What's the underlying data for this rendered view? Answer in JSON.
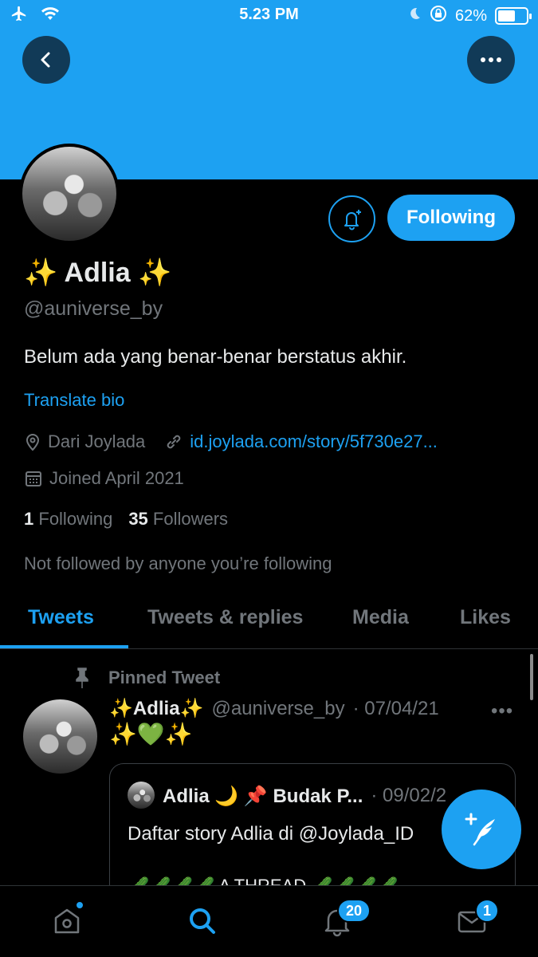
{
  "status_bar": {
    "time": "5.23 PM",
    "battery": "62%",
    "battery_level": 0.62
  },
  "profile": {
    "name": "✨ Adlia ✨",
    "handle": "@auniverse_by",
    "bio": "Belum ada yang benar-benar berstatus akhir.",
    "translate_label": "Translate bio",
    "location": "Dari Joylada",
    "website": "id.joylada.com/story/5f730e27...",
    "joined": "Joined April 2021",
    "following_count": "1",
    "following_label": "Following",
    "followers_count": "35",
    "followers_label": "Followers",
    "not_followed_text": "Not followed by anyone you’re following",
    "follow_button_label": "Following"
  },
  "tabs": [
    {
      "label": "Tweets",
      "active": true
    },
    {
      "label": "Tweets & replies",
      "active": false
    },
    {
      "label": "Media",
      "active": false
    },
    {
      "label": "Likes",
      "active": false
    }
  ],
  "pinned_tweet": {
    "pinned_label": "Pinned Tweet",
    "author_name": "✨Adlia✨",
    "author_handle": "@auniverse_by",
    "date": "· 07/04/21",
    "text": "✨💚✨",
    "quote": {
      "author_name": "Adlia 🌙 📌 Budak P...",
      "date": "· 09/02/2",
      "text": "Daftar story Adlia di @Joylada_ID",
      "text2": "🥒🥒🥒🥒 A THREAD 🥒🥒🥒🥒"
    }
  },
  "bottom_nav": {
    "notifications_badge": "20",
    "messages_badge": "1"
  },
  "colors": {
    "accent": "#1da1f2",
    "background": "#000000",
    "secondary_text": "#71767b"
  }
}
